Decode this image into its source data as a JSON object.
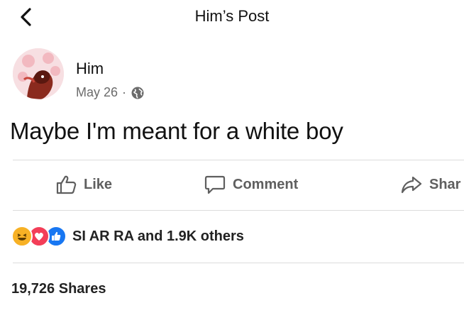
{
  "header": {
    "title": "Him’s Post"
  },
  "post": {
    "author": "Him",
    "date": "May 26",
    "separator": "·",
    "audience_icon": "globe-icon",
    "text": "Maybe I'm meant for a white boy"
  },
  "actions": {
    "like": {
      "label": "Like",
      "icon": "thumbs-up-icon"
    },
    "comment": {
      "label": "Comment",
      "icon": "comment-icon"
    },
    "share": {
      "label": "Shar",
      "icon": "share-arrow-icon"
    }
  },
  "reactions": {
    "icons": [
      "haha-icon",
      "love-icon",
      "like-icon"
    ],
    "summary": "SI AR RA and 1.9K others"
  },
  "shares": {
    "label": "19,726 Shares"
  },
  "colors": {
    "like_blue": "#1877f2",
    "love_red": "#f33e58",
    "haha_yellow": "#f7b125",
    "muted_text": "#6b6b6b"
  }
}
